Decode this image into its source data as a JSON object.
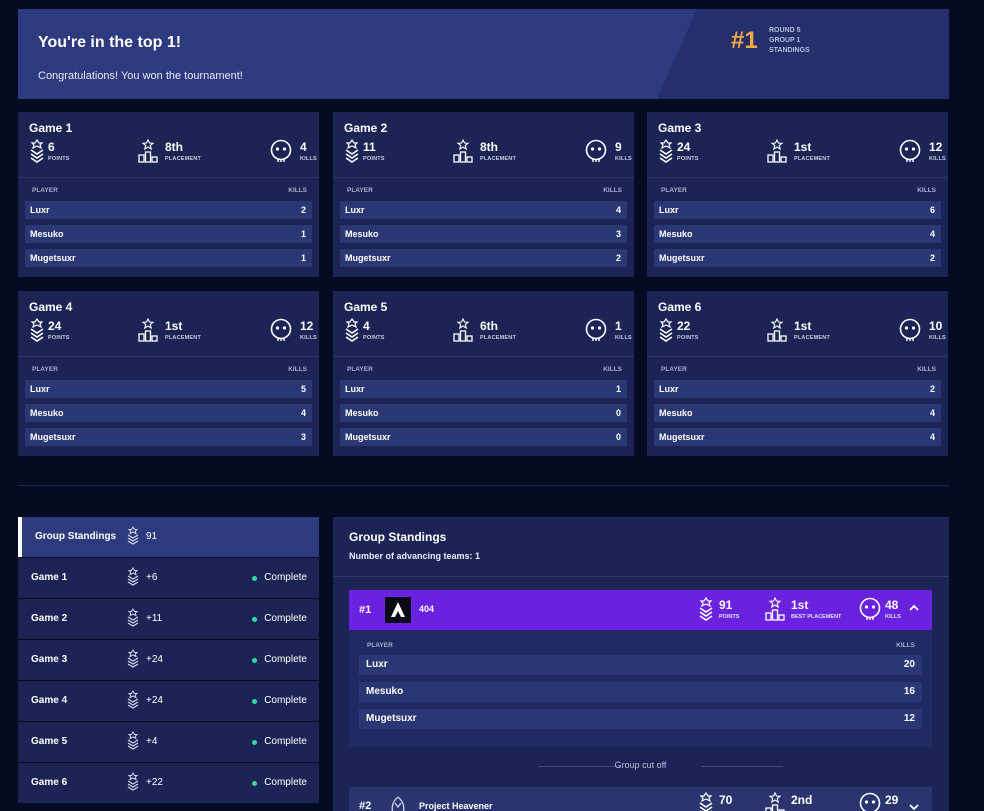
{
  "banner": {
    "title": "You're in the top 1!",
    "subtitle": "Congratulations! You won the tournament!",
    "rank": "#1",
    "meta": [
      "ROUND 5",
      "GROUP 1",
      "STANDINGS"
    ]
  },
  "labels": {
    "points": "POINTS",
    "placement": "PLACEMENT",
    "kills": "KILLS",
    "player": "PLAYER",
    "best_placement": "BEST PLACEMENT"
  },
  "games": [
    {
      "title": "Game 1",
      "points": "6",
      "placement": "8th",
      "kills": "4",
      "players": [
        {
          "name": "Luxr",
          "kills": "2"
        },
        {
          "name": "Mesuko",
          "kills": "1"
        },
        {
          "name": "Mugetsuxr",
          "kills": "1"
        }
      ]
    },
    {
      "title": "Game 2",
      "points": "11",
      "placement": "8th",
      "kills": "9",
      "players": [
        {
          "name": "Luxr",
          "kills": "4"
        },
        {
          "name": "Mesuko",
          "kills": "3"
        },
        {
          "name": "Mugetsuxr",
          "kills": "2"
        }
      ]
    },
    {
      "title": "Game 3",
      "points": "24",
      "placement": "1st",
      "kills": "12",
      "players": [
        {
          "name": "Luxr",
          "kills": "6"
        },
        {
          "name": "Mesuko",
          "kills": "4"
        },
        {
          "name": "Mugetsuxr",
          "kills": "2"
        }
      ]
    },
    {
      "title": "Game 4",
      "points": "24",
      "placement": "1st",
      "kills": "12",
      "players": [
        {
          "name": "Luxr",
          "kills": "5"
        },
        {
          "name": "Mesuko",
          "kills": "4"
        },
        {
          "name": "Mugetsuxr",
          "kills": "3"
        }
      ]
    },
    {
      "title": "Game 5",
      "points": "4",
      "placement": "6th",
      "kills": "1",
      "players": [
        {
          "name": "Luxr",
          "kills": "1"
        },
        {
          "name": "Mesuko",
          "kills": "0"
        },
        {
          "name": "Mugetsuxr",
          "kills": "0"
        }
      ]
    },
    {
      "title": "Game 6",
      "points": "22",
      "placement": "1st",
      "kills": "10",
      "players": [
        {
          "name": "Luxr",
          "kills": "2"
        },
        {
          "name": "Mesuko",
          "kills": "4"
        },
        {
          "name": "Mugetsuxr",
          "kills": "4"
        }
      ]
    }
  ],
  "sidebar": {
    "items": [
      {
        "label": "Group Standings",
        "points": "91",
        "status": ""
      },
      {
        "label": "Game 1",
        "points": "+6",
        "status": "Complete"
      },
      {
        "label": "Game 2",
        "points": "+11",
        "status": "Complete"
      },
      {
        "label": "Game 3",
        "points": "+24",
        "status": "Complete"
      },
      {
        "label": "Game 4",
        "points": "+24",
        "status": "Complete"
      },
      {
        "label": "Game 5",
        "points": "+4",
        "status": "Complete"
      },
      {
        "label": "Game 6",
        "points": "+22",
        "status": "Complete"
      }
    ]
  },
  "standings": {
    "title": "Group Standings",
    "subtitle": "Number of advancing teams: 1",
    "cutoff": "Group cut off",
    "teams": [
      {
        "rank": "#1",
        "name": "404",
        "points": "91",
        "best_placement": "1st",
        "kills": "48",
        "players": [
          {
            "name": "Luxr",
            "kills": "20"
          },
          {
            "name": "Mesuko",
            "kills": "16"
          },
          {
            "name": "Mugetsuxr",
            "kills": "12"
          }
        ]
      },
      {
        "rank": "#2",
        "name": "Project Heavener",
        "points": "70",
        "best_placement": "2nd",
        "kills": "29"
      }
    ]
  },
  "colors": {
    "background": "#060b24",
    "card": "#1b2455",
    "banner": "#2d3a7e",
    "accent_gold": "#f2a944",
    "team_highlight": "#6a22e0",
    "complete_dot": "#3bd6a0"
  }
}
